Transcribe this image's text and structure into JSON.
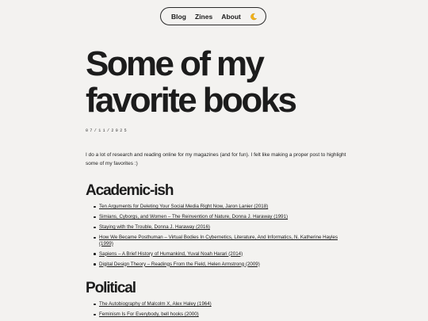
{
  "nav": {
    "items": [
      "Blog",
      "Zines",
      "About"
    ],
    "theme_icon": "moon-icon"
  },
  "post": {
    "title": "Some of my favorite books",
    "date": "07/11/2025",
    "intro": "I do a lot of research and reading online for my magazines (and for fun). I felt like making a proper post to highlight some of my favorites :)"
  },
  "sections": [
    {
      "heading": "Academic-ish",
      "books": [
        "Ten Arguments for Deleting Your Social Media Right Now, Jaron Lanier (2018)",
        "Simians, Cyborgs, and Women – The Reinvention of Nature, Donna J. Haraway (1991)",
        "Staying with the Trouble, Donna J. Haraway (2016)",
        "How We Became Posthuman – Virtual Bodies In Cybernetics, Literature, And Informatics, N. Katherine Hayles (1999)",
        "Sapiens – A Brief History of Humankind, Yuval Noah Harari (2014)",
        "Digital Design Theory – Readings From the Field, Helen Armstrong (2009)"
      ]
    },
    {
      "heading": "Political",
      "books": [
        "The Autobiography of Malcolm X, Alex Haley (1964)",
        "Feminism Is For Everybody, bell hooks (2000)"
      ]
    }
  ]
}
